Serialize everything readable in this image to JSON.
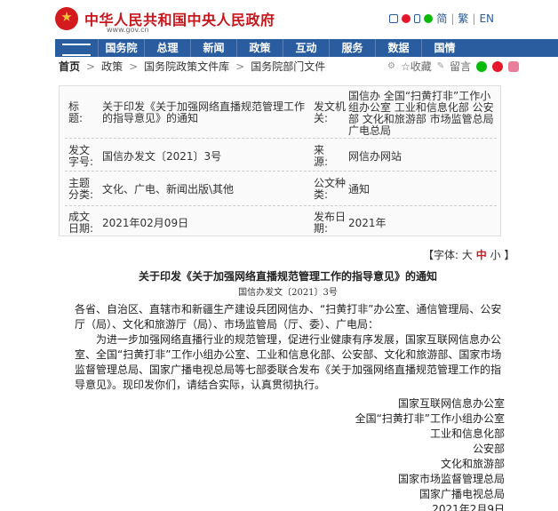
{
  "header": {
    "site_title": "中华人民共和国中央人民政府",
    "domain": "www.gov.cn",
    "lang_simplified": "简",
    "lang_traditional": "繁",
    "lang_en": "EN"
  },
  "nav": {
    "items": [
      "国务院",
      "总理",
      "新闻",
      "政策",
      "互动",
      "服务",
      "数据",
      "国情"
    ]
  },
  "breadcrumb": {
    "home": "首页",
    "items": [
      "政策",
      "国务院政策文件库",
      "国务院部门文件"
    ],
    "separator": ">",
    "favorite": "☆收藏",
    "comment": "留言"
  },
  "meta": {
    "title_label": "标　　题:",
    "title_value": "关于印发《关于加强网络直播规范管理工作的指导意见》的通知",
    "issuer_label": "发文机关:",
    "issuer_value": "国信办 全国“扫黄打非”工作小组办公室 工业和信息化部 公安部 文化和旅游部 市场监管总局 广电总局",
    "docno_label": "发文字号:",
    "docno_value": "国信办发文〔2021〕3号",
    "source_label": "来　　源:",
    "source_value": "网信办网站",
    "category_label": "主题分类:",
    "category_value": "文化、广电、新闻出版\\其他",
    "type_label": "公文种类:",
    "type_value": "通知",
    "written_label": "成文日期:",
    "written_value": "2021年02月09日",
    "published_label": "发布日期:",
    "published_value": "2021年"
  },
  "fontsize": {
    "prefix": "【字体:",
    "large": "大",
    "medium": "中",
    "small": "小",
    "suffix": "】"
  },
  "article": {
    "title": "关于印发《关于加强网络直播规范管理工作的指导意见》的通知",
    "docno": "国信办发文〔2021〕3号",
    "salutation": "各省、自治区、直辖市和新疆生产建设兵团网信办、“扫黄打非”办公室、通信管理局、公安厅（局）、文化和旅游厅（局）、市场监管局（厅、委）、广电局：",
    "paragraph": "为进一步加强网络直播行业的规范管理，促进行业健康有序发展，国家互联网信息办公室、全国“扫黄打非”工作小组办公室、工业和信息化部、公安部、文化和旅游部、国家市场监督管理总局、国家广播电视总局等七部委联合发布《关于加强网络直播规范管理工作的指导意见》。现印发你们，请结合实际，认真贯彻执行。",
    "signatories": [
      "国家互联网信息办公室",
      "全国“扫黄打非”工作小组办公室",
      "工业和信息化部",
      "公安部",
      "文化和旅游部",
      "国家市场监督管理总局",
      "国家广播电视总局"
    ],
    "date": "2021年2月9日"
  }
}
